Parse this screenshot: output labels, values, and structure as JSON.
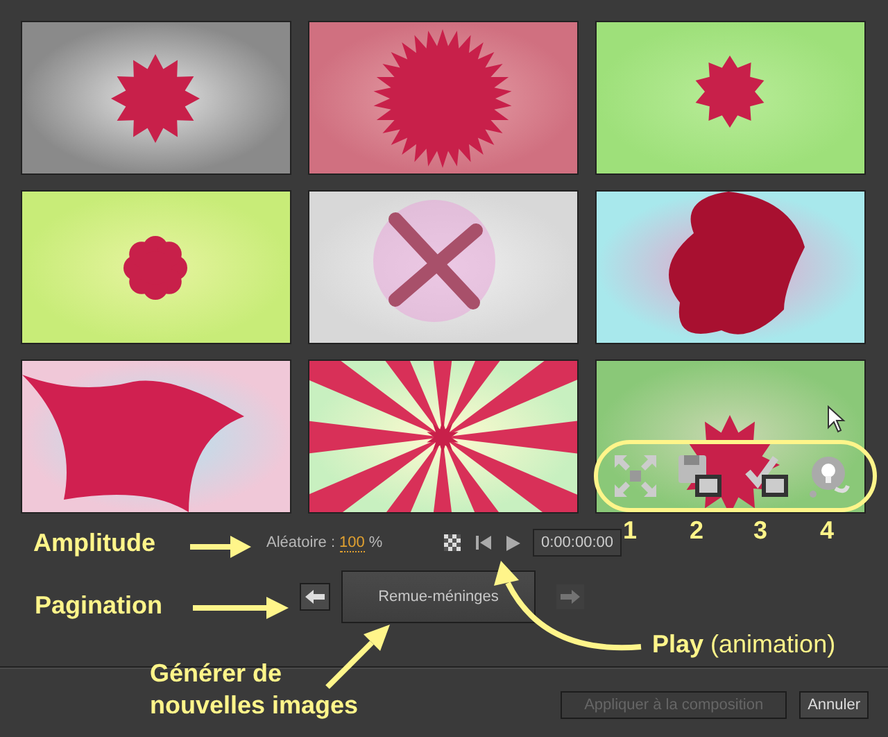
{
  "controls": {
    "randomness_label": "Aléatoire :",
    "randomness_value": "100",
    "randomness_unit": "%",
    "timecode": "0:00:00:00",
    "brainstorm_button": "Remue-méninges",
    "prev_page_disabled": false,
    "next_page_disabled": true
  },
  "footer": {
    "buttons": [
      {
        "label": "Appliquer à la composition",
        "disabled": true
      },
      {
        "label": "Annuler",
        "disabled": false
      }
    ]
  },
  "annotations": {
    "amplitude": "Amplitude",
    "pagination": "Pagination",
    "generate": "Générer de nouvelles images",
    "play": "**Play** (animation)",
    "numbers": [
      "1",
      "2",
      "3",
      "4"
    ]
  }
}
